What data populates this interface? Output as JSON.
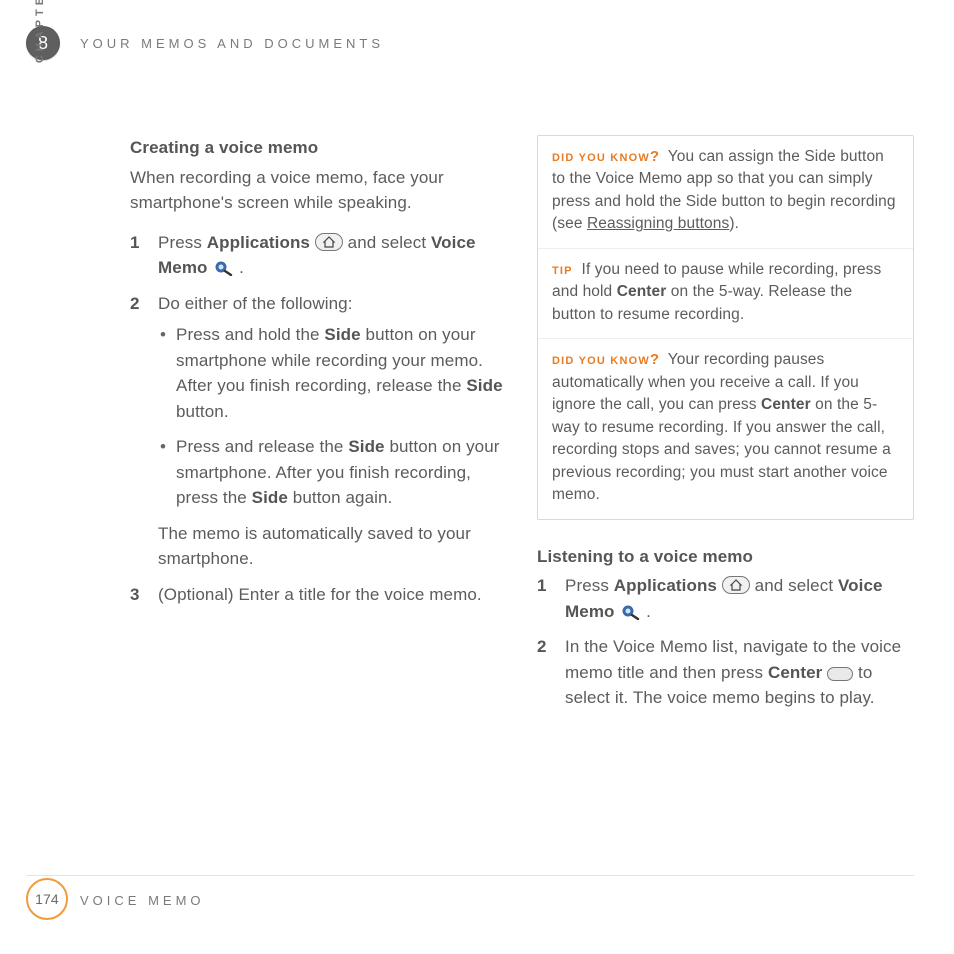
{
  "chapter_number": "8",
  "chapter_label": "CHAPTER",
  "header": "YOUR MEMOS AND DOCUMENTS",
  "page_number": "174",
  "footer_label": "VOICE MEMO",
  "left": {
    "heading": "Creating a voice memo",
    "intro": "When recording a voice memo, face your smartphone's screen while speaking.",
    "step1": {
      "pre": "Press ",
      "apps": "Applications",
      "mid": " and select ",
      "vm": "Voice Memo",
      "end": " ."
    },
    "step2_lead": "Do either of the following:",
    "b1": {
      "p1": "Press and hold the ",
      "side1": "Side",
      "p2": " button on your smartphone while recording your memo. After you finish recording, release the ",
      "side2": "Side",
      "p3": " button."
    },
    "b2": {
      "p1": "Press and release the ",
      "side1": "Side",
      "p2": " button on your smartphone. After you finish recording, press the ",
      "side2": "Side",
      "p3": " button again."
    },
    "after_bullets": "The memo is automatically saved to your smartphone.",
    "step3": "(Optional)  Enter a title for the voice memo."
  },
  "tipbox": {
    "dyk_label": "DID YOU KNOW",
    "tip_label": "TIP",
    "t1": {
      "p1": "You can assign the Side button to the Voice Memo app so that you can simply press and hold the Side button to begin recording (see ",
      "link": "Reassigning buttons",
      "p2": ")."
    },
    "t2": {
      "p1": "If you need to pause while recording, press and hold ",
      "center": "Center",
      "p2": " on the 5-way. Release the button to resume recording."
    },
    "t3": {
      "p1": "Your recording pauses automatically when you receive a call. If you ignore the call, you can press ",
      "center": "Center",
      "p2": " on the 5-way to resume recording. If you answer the call, recording stops and saves; you cannot resume a previous recording; you must start another voice memo."
    }
  },
  "right": {
    "heading": "Listening to a voice memo",
    "step1": {
      "pre": "Press ",
      "apps": "Applications",
      "mid": " and select ",
      "vm": "Voice Memo",
      "end": " ."
    },
    "step2": {
      "p1": "In the Voice Memo list, navigate to the voice memo title and then press ",
      "center": "Center",
      "p2": " to select it. The voice memo begins to play."
    }
  }
}
